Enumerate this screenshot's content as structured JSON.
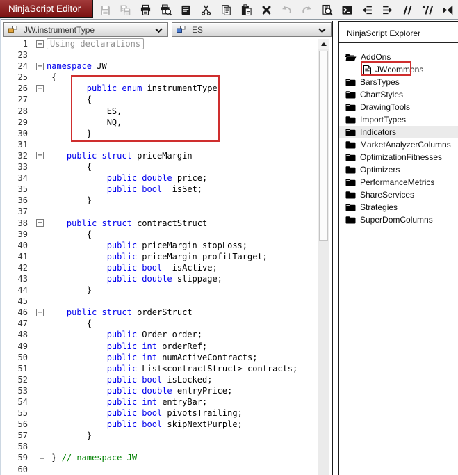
{
  "window": {
    "title": "NinjaScript Editor"
  },
  "toolbar": {
    "items": [
      {
        "name": "save",
        "enabled": false
      },
      {
        "name": "save-all",
        "enabled": false
      },
      {
        "name": "print",
        "enabled": true
      },
      {
        "name": "print-preview",
        "enabled": true
      },
      {
        "name": "code-snippets",
        "enabled": true
      },
      {
        "name": "cut",
        "enabled": true
      },
      {
        "name": "copy",
        "enabled": true
      },
      {
        "name": "paste",
        "enabled": true
      },
      {
        "name": "delete",
        "enabled": true
      },
      {
        "name": "undo",
        "enabled": false
      },
      {
        "name": "redo",
        "enabled": false
      },
      {
        "name": "find",
        "enabled": true
      },
      {
        "name": "compile",
        "enabled": true
      },
      {
        "name": "outdent",
        "enabled": true
      },
      {
        "name": "indent",
        "enabled": true
      },
      {
        "name": "comment-selection",
        "enabled": true
      },
      {
        "name": "uncomment-selection",
        "enabled": true
      },
      {
        "name": "visual-studio",
        "enabled": true
      }
    ]
  },
  "dropdowns": {
    "type_selector": {
      "value": "JW.instrumentType"
    },
    "member_selector": {
      "value": "ES"
    }
  },
  "explorer": {
    "title": "NinjaScript Explorer",
    "tree": [
      {
        "label": "AddOns",
        "type": "folder-open",
        "level": 0,
        "selected": false
      },
      {
        "label": "JWcommons",
        "type": "file",
        "level": 1,
        "selected": false
      },
      {
        "label": "BarsTypes",
        "type": "folder",
        "level": 0,
        "selected": false
      },
      {
        "label": "ChartStyles",
        "type": "folder",
        "level": 0,
        "selected": false
      },
      {
        "label": "DrawingTools",
        "type": "folder",
        "level": 0,
        "selected": false
      },
      {
        "label": "ImportTypes",
        "type": "folder",
        "level": 0,
        "selected": false
      },
      {
        "label": "Indicators",
        "type": "folder",
        "level": 0,
        "selected": true
      },
      {
        "label": "MarketAnalyzerColumns",
        "type": "folder",
        "level": 0,
        "selected": false
      },
      {
        "label": "OptimizationFitnesses",
        "type": "folder",
        "level": 0,
        "selected": false
      },
      {
        "label": "Optimizers",
        "type": "folder",
        "level": 0,
        "selected": false
      },
      {
        "label": "PerformanceMetrics",
        "type": "folder",
        "level": 0,
        "selected": false
      },
      {
        "label": "ShareServices",
        "type": "folder",
        "level": 0,
        "selected": false
      },
      {
        "label": "Strategies",
        "type": "folder",
        "level": 0,
        "selected": false
      },
      {
        "label": "SuperDomColumns",
        "type": "folder",
        "level": 0,
        "selected": false
      }
    ]
  },
  "editor": {
    "lines": [
      {
        "num": "1",
        "fold": "plus",
        "segments": [
          {
            "c": "boxed",
            "t": "Using declarations"
          }
        ]
      },
      {
        "num": "23",
        "fold": "",
        "segments": []
      },
      {
        "num": "24",
        "fold": "minus",
        "segments": [
          {
            "c": "kw",
            "t": "namespace"
          },
          {
            "c": "pl",
            "t": " JW"
          }
        ]
      },
      {
        "num": "25",
        "fold": "line",
        "segments": [
          {
            "c": "pl",
            "t": " {"
          }
        ]
      },
      {
        "num": "26",
        "fold": "minus-line",
        "segments": [
          {
            "c": "pl",
            "t": "        "
          },
          {
            "c": "kw",
            "t": "public"
          },
          {
            "c": "pl",
            "t": " "
          },
          {
            "c": "kw",
            "t": "enum"
          },
          {
            "c": "pl",
            "t": " instrumentType"
          }
        ]
      },
      {
        "num": "27",
        "fold": "line",
        "segments": [
          {
            "c": "pl",
            "t": "        {"
          }
        ]
      },
      {
        "num": "28",
        "fold": "line",
        "segments": [
          {
            "c": "pl",
            "t": "            ES,"
          }
        ]
      },
      {
        "num": "29",
        "fold": "line",
        "segments": [
          {
            "c": "pl",
            "t": "            NQ,"
          }
        ]
      },
      {
        "num": "30",
        "fold": "line",
        "segments": [
          {
            "c": "pl",
            "t": "        }"
          }
        ]
      },
      {
        "num": "31",
        "fold": "line",
        "segments": []
      },
      {
        "num": "32",
        "fold": "minus-line",
        "segments": [
          {
            "c": "pl",
            "t": "    "
          },
          {
            "c": "kw",
            "t": "public"
          },
          {
            "c": "pl",
            "t": " "
          },
          {
            "c": "kw",
            "t": "struct"
          },
          {
            "c": "pl",
            "t": " priceMargin"
          }
        ]
      },
      {
        "num": "33",
        "fold": "line",
        "segments": [
          {
            "c": "pl",
            "t": "        {"
          }
        ]
      },
      {
        "num": "34",
        "fold": "line",
        "segments": [
          {
            "c": "pl",
            "t": "            "
          },
          {
            "c": "kw",
            "t": "public"
          },
          {
            "c": "pl",
            "t": " "
          },
          {
            "c": "kw",
            "t": "double"
          },
          {
            "c": "pl",
            "t": " price;"
          }
        ]
      },
      {
        "num": "35",
        "fold": "line",
        "segments": [
          {
            "c": "pl",
            "t": "            "
          },
          {
            "c": "kw",
            "t": "public"
          },
          {
            "c": "pl",
            "t": " "
          },
          {
            "c": "kw",
            "t": "bool"
          },
          {
            "c": "pl",
            "t": "  isSet;"
          }
        ]
      },
      {
        "num": "36",
        "fold": "line",
        "segments": [
          {
            "c": "pl",
            "t": "        }"
          }
        ]
      },
      {
        "num": "37",
        "fold": "line",
        "segments": []
      },
      {
        "num": "38",
        "fold": "minus-line",
        "segments": [
          {
            "c": "pl",
            "t": "    "
          },
          {
            "c": "kw",
            "t": "public"
          },
          {
            "c": "pl",
            "t": " "
          },
          {
            "c": "kw",
            "t": "struct"
          },
          {
            "c": "pl",
            "t": " contractStruct"
          }
        ]
      },
      {
        "num": "39",
        "fold": "line",
        "segments": [
          {
            "c": "pl",
            "t": "        {"
          }
        ]
      },
      {
        "num": "40",
        "fold": "line",
        "segments": [
          {
            "c": "pl",
            "t": "            "
          },
          {
            "c": "kw",
            "t": "public"
          },
          {
            "c": "pl",
            "t": " priceMargin stopLoss;"
          }
        ]
      },
      {
        "num": "41",
        "fold": "line",
        "segments": [
          {
            "c": "pl",
            "t": "            "
          },
          {
            "c": "kw",
            "t": "public"
          },
          {
            "c": "pl",
            "t": " priceMargin profitTarget;"
          }
        ]
      },
      {
        "num": "42",
        "fold": "line",
        "segments": [
          {
            "c": "pl",
            "t": "            "
          },
          {
            "c": "kw",
            "t": "public"
          },
          {
            "c": "pl",
            "t": " "
          },
          {
            "c": "kw",
            "t": "bool"
          },
          {
            "c": "pl",
            "t": "  isActive;"
          }
        ]
      },
      {
        "num": "43",
        "fold": "line",
        "segments": [
          {
            "c": "pl",
            "t": "            "
          },
          {
            "c": "kw",
            "t": "public"
          },
          {
            "c": "pl",
            "t": " "
          },
          {
            "c": "kw",
            "t": "double"
          },
          {
            "c": "pl",
            "t": " slippage;"
          }
        ]
      },
      {
        "num": "44",
        "fold": "line",
        "segments": [
          {
            "c": "pl",
            "t": "        }"
          }
        ]
      },
      {
        "num": "45",
        "fold": "line",
        "segments": []
      },
      {
        "num": "46",
        "fold": "minus-line",
        "segments": [
          {
            "c": "pl",
            "t": "    "
          },
          {
            "c": "kw",
            "t": "public"
          },
          {
            "c": "pl",
            "t": " "
          },
          {
            "c": "kw",
            "t": "struct"
          },
          {
            "c": "pl",
            "t": " orderStruct"
          }
        ]
      },
      {
        "num": "47",
        "fold": "line",
        "segments": [
          {
            "c": "pl",
            "t": "        {"
          }
        ]
      },
      {
        "num": "48",
        "fold": "line",
        "segments": [
          {
            "c": "pl",
            "t": "            "
          },
          {
            "c": "kw",
            "t": "public"
          },
          {
            "c": "pl",
            "t": " Order order;"
          }
        ]
      },
      {
        "num": "49",
        "fold": "line",
        "segments": [
          {
            "c": "pl",
            "t": "            "
          },
          {
            "c": "kw",
            "t": "public"
          },
          {
            "c": "pl",
            "t": " "
          },
          {
            "c": "kw",
            "t": "int"
          },
          {
            "c": "pl",
            "t": " orderRef;"
          }
        ]
      },
      {
        "num": "50",
        "fold": "line",
        "segments": [
          {
            "c": "pl",
            "t": "            "
          },
          {
            "c": "kw",
            "t": "public"
          },
          {
            "c": "pl",
            "t": " "
          },
          {
            "c": "kw",
            "t": "int"
          },
          {
            "c": "pl",
            "t": " numActiveContracts;"
          }
        ]
      },
      {
        "num": "51",
        "fold": "line",
        "segments": [
          {
            "c": "pl",
            "t": "            "
          },
          {
            "c": "kw",
            "t": "public"
          },
          {
            "c": "pl",
            "t": " List<contractStruct> contracts;"
          }
        ]
      },
      {
        "num": "52",
        "fold": "line",
        "segments": [
          {
            "c": "pl",
            "t": "            "
          },
          {
            "c": "kw",
            "t": "public"
          },
          {
            "c": "pl",
            "t": " "
          },
          {
            "c": "kw",
            "t": "bool"
          },
          {
            "c": "pl",
            "t": " isLocked;"
          }
        ]
      },
      {
        "num": "53",
        "fold": "line",
        "segments": [
          {
            "c": "pl",
            "t": "            "
          },
          {
            "c": "kw",
            "t": "public"
          },
          {
            "c": "pl",
            "t": " "
          },
          {
            "c": "kw",
            "t": "double"
          },
          {
            "c": "pl",
            "t": " entryPrice;"
          }
        ]
      },
      {
        "num": "54",
        "fold": "line",
        "segments": [
          {
            "c": "pl",
            "t": "            "
          },
          {
            "c": "kw",
            "t": "public"
          },
          {
            "c": "pl",
            "t": " "
          },
          {
            "c": "kw",
            "t": "int"
          },
          {
            "c": "pl",
            "t": " entryBar;"
          }
        ]
      },
      {
        "num": "55",
        "fold": "line",
        "segments": [
          {
            "c": "pl",
            "t": "            "
          },
          {
            "c": "kw",
            "t": "public"
          },
          {
            "c": "pl",
            "t": " "
          },
          {
            "c": "kw",
            "t": "bool"
          },
          {
            "c": "pl",
            "t": " pivotsTrailing;"
          }
        ]
      },
      {
        "num": "56",
        "fold": "line",
        "segments": [
          {
            "c": "pl",
            "t": "            "
          },
          {
            "c": "kw",
            "t": "public"
          },
          {
            "c": "pl",
            "t": " "
          },
          {
            "c": "kw",
            "t": "bool"
          },
          {
            "c": "pl",
            "t": " skipNextPurple;"
          }
        ]
      },
      {
        "num": "57",
        "fold": "line",
        "segments": [
          {
            "c": "pl",
            "t": "        }"
          }
        ]
      },
      {
        "num": "58",
        "fold": "line",
        "segments": []
      },
      {
        "num": "59",
        "fold": "corner",
        "segments": [
          {
            "c": "pl",
            "t": " } "
          },
          {
            "c": "cm",
            "t": "// namespace JW"
          }
        ]
      },
      {
        "num": "60",
        "fold": "",
        "segments": []
      }
    ]
  },
  "colors": {
    "annotation_red": "#cf2e2e",
    "keyword_blue": "#0000ee",
    "comment_green": "#008000",
    "title_bg_red": "#8c1f1f",
    "selection_gray": "#ebebeb"
  }
}
